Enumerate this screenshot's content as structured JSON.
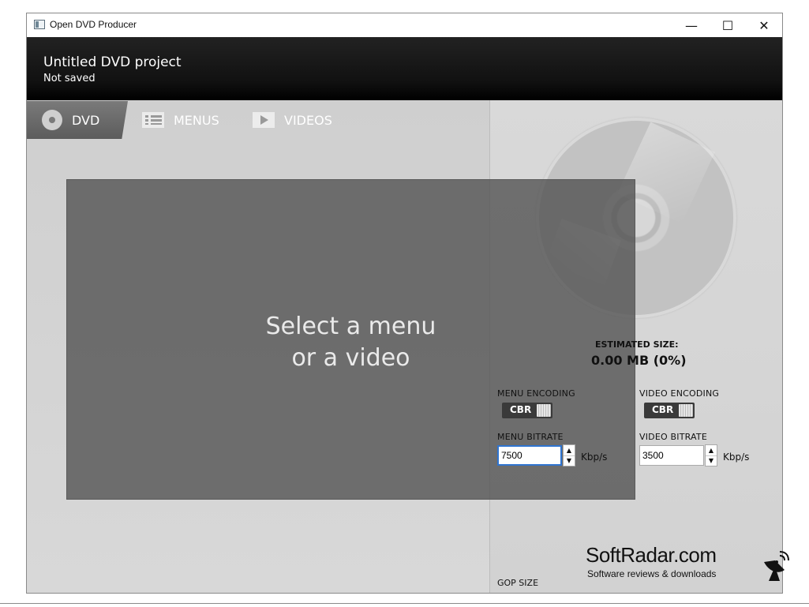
{
  "window": {
    "title": "Open DVD Producer",
    "controls": {
      "minimize": "—",
      "maximize": "☐",
      "close": "✕"
    }
  },
  "header": {
    "project_title": "Untitled DVD project",
    "status": "Not saved"
  },
  "tabs": [
    {
      "label": "DVD",
      "icon": "disc-icon",
      "active": true
    },
    {
      "label": "MENUS",
      "icon": "menu-list-icon",
      "active": false
    },
    {
      "label": "VIDEOS",
      "icon": "play-icon",
      "active": false
    }
  ],
  "preview": {
    "line1": "Select a menu",
    "line2": "or a video"
  },
  "estimate": {
    "label": "ESTIMATED SIZE:",
    "value": "0.00 MB (0%)"
  },
  "menu_encoding": {
    "label": "MENU ENCODING",
    "value": "CBR"
  },
  "video_encoding": {
    "label": "VIDEO ENCODING",
    "value": "CBR"
  },
  "menu_bitrate": {
    "label": "MENU BITRATE",
    "value": "7500",
    "unit": "Kbp/s"
  },
  "video_bitrate": {
    "label": "VIDEO BITRATE",
    "value": "3500",
    "unit": "Kbp/s"
  },
  "gop": {
    "label": "GOP SIZE"
  },
  "watermark": {
    "name": "SoftRadar.com",
    "tagline": "Software reviews & downloads"
  },
  "colors": {
    "accent_focus": "#2f74d0",
    "header_bg": "#111111",
    "tab_active": "#6a6a6a"
  }
}
